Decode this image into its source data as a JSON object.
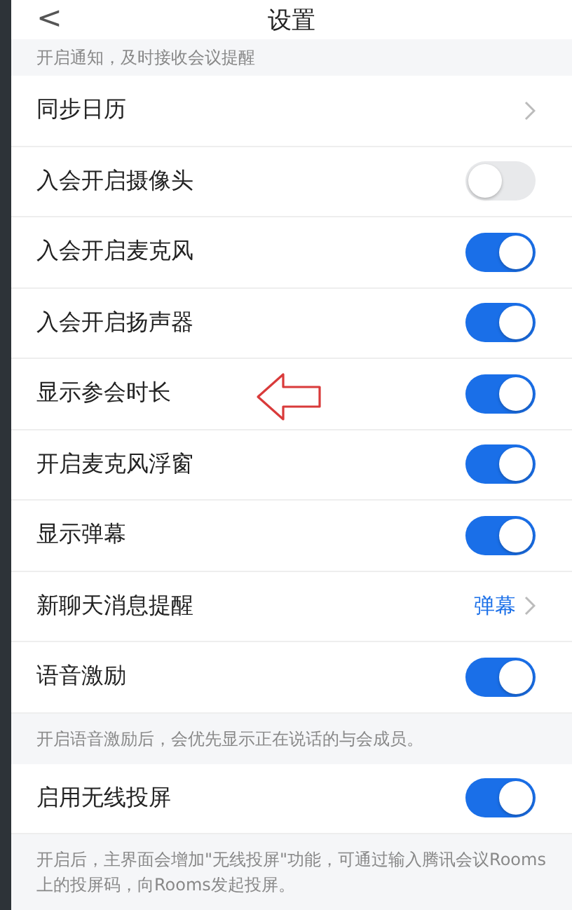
{
  "header": {
    "back": "<",
    "title": "设置"
  },
  "top_note": "开启通知，及时接收会议提醒",
  "sections": [
    {
      "rows": [
        {
          "kind": "link",
          "label": "同步日历"
        },
        {
          "kind": "toggle",
          "label": "入会开启摄像头",
          "on": false
        },
        {
          "kind": "toggle",
          "label": "入会开启麦克风",
          "on": true
        },
        {
          "kind": "toggle",
          "label": "入会开启扬声器",
          "on": true
        },
        {
          "kind": "toggle",
          "label": "显示参会时长",
          "on": true,
          "annotated": true
        },
        {
          "kind": "toggle",
          "label": "开启麦克风浮窗",
          "on": true
        },
        {
          "kind": "toggle",
          "label": "显示弹幕",
          "on": true
        },
        {
          "kind": "link",
          "label": "新聊天消息提醒",
          "value": "弹幕"
        },
        {
          "kind": "toggle",
          "label": "语音激励",
          "on": true
        }
      ],
      "note": "开启语音激励后，会优先显示正在说话的与会成员。"
    },
    {
      "rows": [
        {
          "kind": "toggle",
          "label": "启用无线投屏",
          "on": true
        }
      ],
      "note": "开启后，主界面会增加\"无线投屏\"功能，可通过输入腾讯会议Rooms上的投屏码，向Rooms发起投屏。"
    }
  ]
}
